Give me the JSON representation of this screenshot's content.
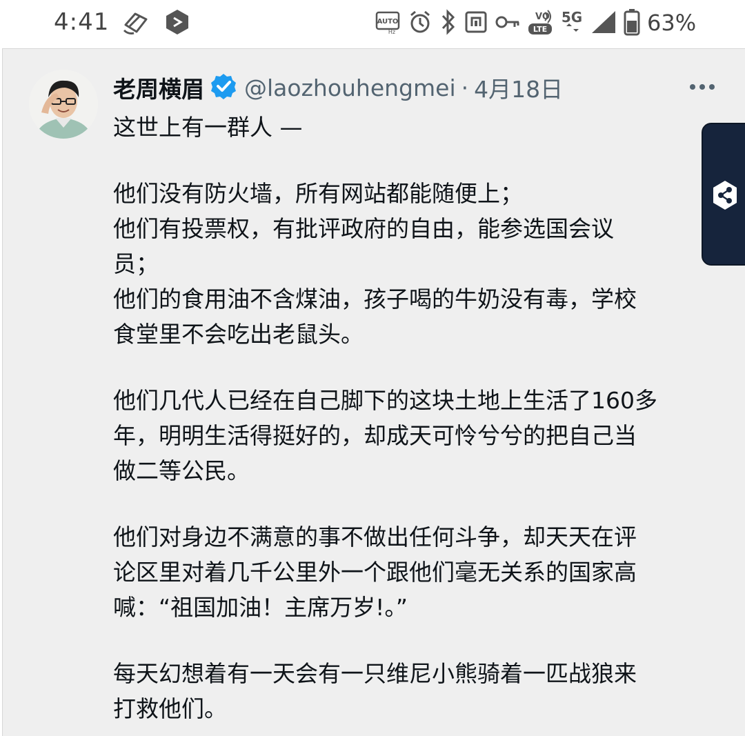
{
  "status_bar": {
    "time": "4:41",
    "battery_percent": "63%",
    "network_label": "5G",
    "icons": [
      "sync-icon",
      "app-icon",
      "auto-hz-icon",
      "alarm-icon",
      "bluetooth-icon",
      "nfc-icon",
      "key-icon",
      "volte-icon",
      "5g-icon",
      "signal-icon",
      "battery-icon"
    ]
  },
  "tweet": {
    "author_name": "老周横眉",
    "handle": "@laozhouhengmei",
    "separator": "·",
    "date": "4月18日",
    "verified": true,
    "lines": [
      "这世上有一群人 —",
      "",
      "他们没有防火墙，所有网站都能随便上；",
      "他们有投票权，有批评政府的自由，能参选国会议",
      "员；",
      "他们的食用油不含煤油，孩子喝的牛奶没有毒，学校",
      "食堂里不会吃出老鼠头。",
      "",
      "他们几代人已经在自己脚下的这块土地上生活了160多",
      "年，明明生活得挺好的，却成天可怜兮兮的把自己当",
      "做二等公民。",
      "",
      "他们对身边不满意的事不做出任何斗争，却天天在评",
      "论区里对着几千公里外一个跟他们毫无关系的国家高",
      "喊：“祖国加油！主席万岁!。”",
      "",
      "每天幻想着有一天会有一只维尼小熊骑着一匹战狼来",
      "打救他们。"
    ]
  },
  "colors": {
    "background": "#efefef",
    "text": "#0f1419",
    "muted": "#536471",
    "verified": "#1d9bf0",
    "side_tab": "#16243c"
  }
}
